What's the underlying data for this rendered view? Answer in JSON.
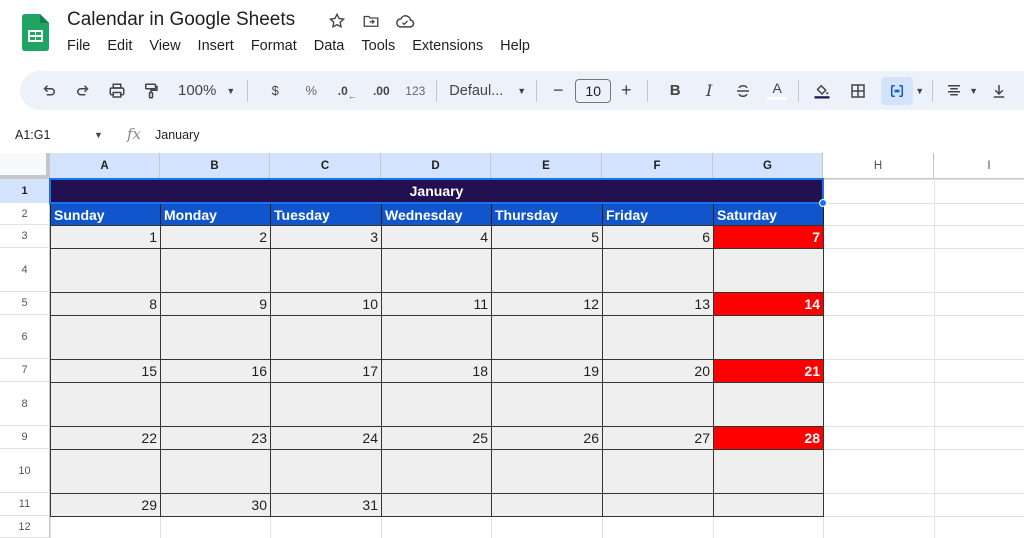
{
  "app": {
    "doc_title": "Calendar in Google Sheets",
    "title_icons": [
      {
        "name": "star-icon",
        "glyph": "☆"
      },
      {
        "name": "move-to-folder-icon",
        "glyph": "⇨"
      },
      {
        "name": "cloud-saved-icon",
        "glyph": "☁"
      }
    ],
    "menu": [
      "File",
      "Edit",
      "View",
      "Insert",
      "Format",
      "Data",
      "Tools",
      "Extensions",
      "Help"
    ]
  },
  "toolbar": {
    "zoom": "100%",
    "currency": "$",
    "percent": "%",
    "decrease_decimal": ".0",
    "increase_decimal": ".00",
    "more_formats": "123",
    "font": "Defaul...",
    "font_size": "10",
    "minus": "−",
    "plus": "+",
    "bold": "B",
    "italic": "I",
    "text_color": "A"
  },
  "formula_bar": {
    "name_box": "A1:G1",
    "fx": "fx",
    "value": "January"
  },
  "sheet": {
    "columns": [
      "A",
      "B",
      "C",
      "D",
      "E",
      "F",
      "G",
      "H",
      "I"
    ],
    "selected_columns": [
      "A",
      "B",
      "C",
      "D",
      "E",
      "F",
      "G"
    ],
    "rows": [
      "1",
      "2",
      "3",
      "4",
      "5",
      "6",
      "7",
      "8",
      "9",
      "10",
      "11",
      "12"
    ],
    "selected_row": "1",
    "month": "January",
    "weekdays": [
      "Sunday",
      "Monday",
      "Tuesday",
      "Wednesday",
      "Thursday",
      "Friday",
      "Saturday"
    ],
    "weeks": [
      [
        "1",
        "2",
        "3",
        "4",
        "5",
        "6",
        "7"
      ],
      [
        "8",
        "9",
        "10",
        "11",
        "12",
        "13",
        "14"
      ],
      [
        "15",
        "16",
        "17",
        "18",
        "19",
        "20",
        "21"
      ],
      [
        "22",
        "23",
        "24",
        "25",
        "26",
        "27",
        "28"
      ],
      [
        "29",
        "30",
        "31",
        "",
        "",
        "",
        ""
      ]
    ],
    "colors": {
      "month_bg": "#221051",
      "weekday_bg": "#1155cc",
      "date_bg": "#efefef",
      "weekend_bg": "#ff0000"
    }
  }
}
